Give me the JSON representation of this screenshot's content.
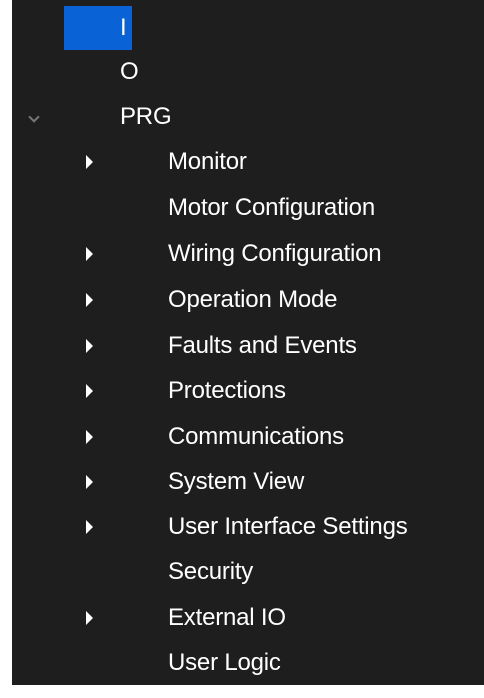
{
  "tree": {
    "root_items": [
      {
        "label": "I",
        "selected": true
      },
      {
        "label": "O"
      },
      {
        "label": "PRG",
        "expanded": true
      }
    ],
    "children": [
      {
        "label": "Monitor",
        "has_children": true
      },
      {
        "label": "Motor Configuration",
        "has_children": false
      },
      {
        "label": "Wiring Configuration",
        "has_children": true
      },
      {
        "label": "Operation Mode",
        "has_children": true
      },
      {
        "label": "Faults and Events",
        "has_children": true
      },
      {
        "label": "Protections",
        "has_children": true
      },
      {
        "label": "Communications",
        "has_children": true
      },
      {
        "label": "System View",
        "has_children": true
      },
      {
        "label": "User Interface Settings",
        "has_children": true
      },
      {
        "label": "Security",
        "has_children": false
      },
      {
        "label": "External IO",
        "has_children": true
      },
      {
        "label": "User Logic",
        "has_children": false
      }
    ]
  },
  "colors": {
    "background": "#1e1e1e",
    "selection": "#0a63d6",
    "text": "#ffffff",
    "expanded_arrow": "#777777"
  },
  "icons": {
    "collapsed_arrow": "chevron-right-icon",
    "expanded_arrow": "chevron-down-icon"
  }
}
